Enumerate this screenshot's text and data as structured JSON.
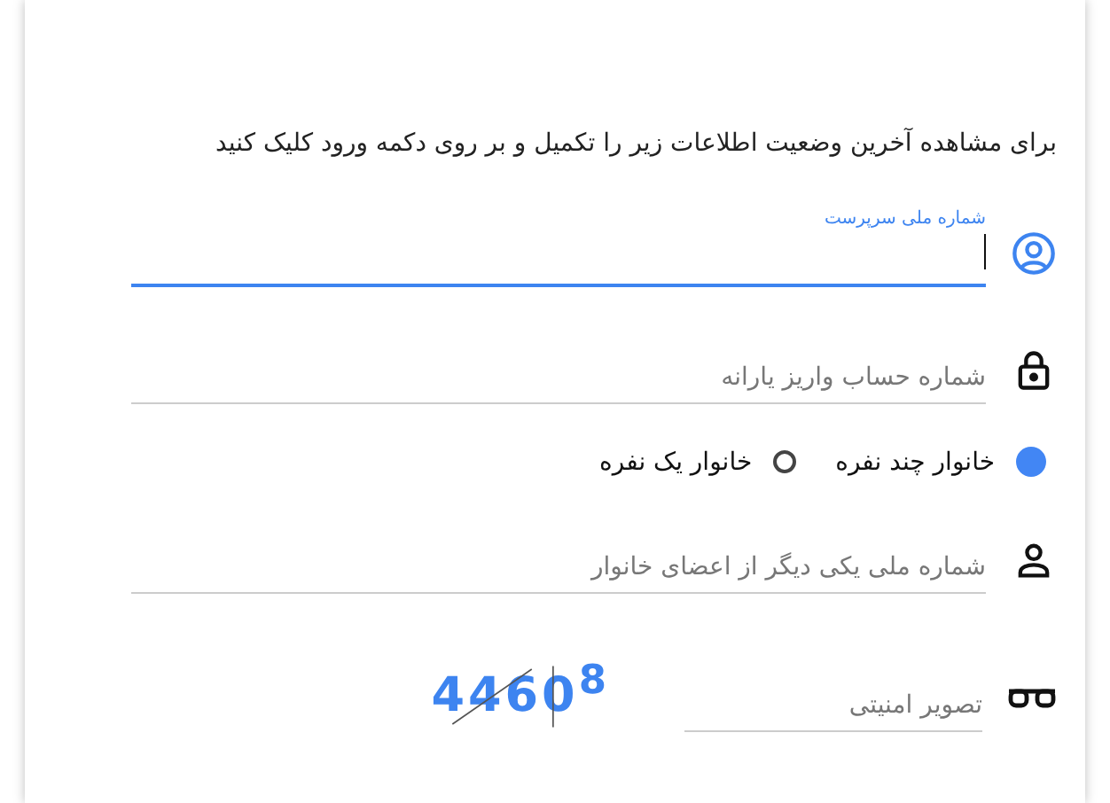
{
  "intro": "برای مشاهده آخرین وضعیت اطلاعات زیر را تکمیل و بر روی دکمه ورود کلیک کنید",
  "fields": [
    {
      "kind": "input",
      "label": "شماره ملی سرپرست",
      "focused": true
    },
    {
      "kind": "input",
      "placeholder": "شماره حساب واریز یارانه",
      "focused": false
    },
    {
      "kind": "radios",
      "options": [
        {
          "label": "خانوار چند نفره",
          "selected": true
        },
        {
          "label": "خانوار یک نفره",
          "selected": false
        }
      ]
    },
    {
      "kind": "input",
      "placeholder": "شماره ملی یکی دیگر از اعضای خانوار",
      "focused": false
    }
  ],
  "captcha": {
    "placeholder": "تصویر امنیتی",
    "code": "4460$^{8}$"
  }
}
